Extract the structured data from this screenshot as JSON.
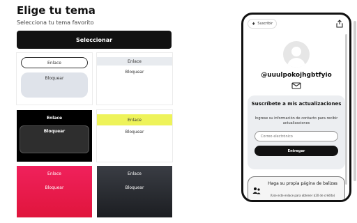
{
  "header": {
    "title": "Elige tu tema",
    "subtitle": "Selecciona tu tema favorito",
    "select_label": "Seleccionar"
  },
  "themes": [
    {
      "link": "Enlace",
      "block": "Bloquear"
    },
    {
      "link": "Enlace",
      "block": "Bloquear"
    },
    {
      "link": "Enlace",
      "block": "Bloquear"
    },
    {
      "link": "Enlace",
      "block": "Bloquear"
    },
    {
      "link": "Enlace",
      "block": "Bloquear"
    },
    {
      "link": "Enlace",
      "block": "Bloquear"
    }
  ],
  "preview": {
    "subscribe_label": "Suscribir",
    "username": "@uuulpokojhgbtfyio",
    "subscribe_box": {
      "title": "Suscríbete a mis actualizaciones",
      "description": "Ingrese su información de contacto para recibir actualizaciones",
      "email_placeholder": "Correo electrónico",
      "submit_label": "Entregar"
    },
    "promo": {
      "title": "Haga su propia página de balizas",
      "note": "(Use este enlace para obtener $20 de crédito)"
    }
  },
  "colors": {
    "accent": "#111111",
    "pink_theme": "#f0215c",
    "yellow_link": "#eef35a",
    "dark_theme": "#2e2e2e"
  },
  "icons": [
    "bell-icon",
    "share-icon",
    "mail-icon",
    "avatar-icon",
    "people-icon"
  ]
}
